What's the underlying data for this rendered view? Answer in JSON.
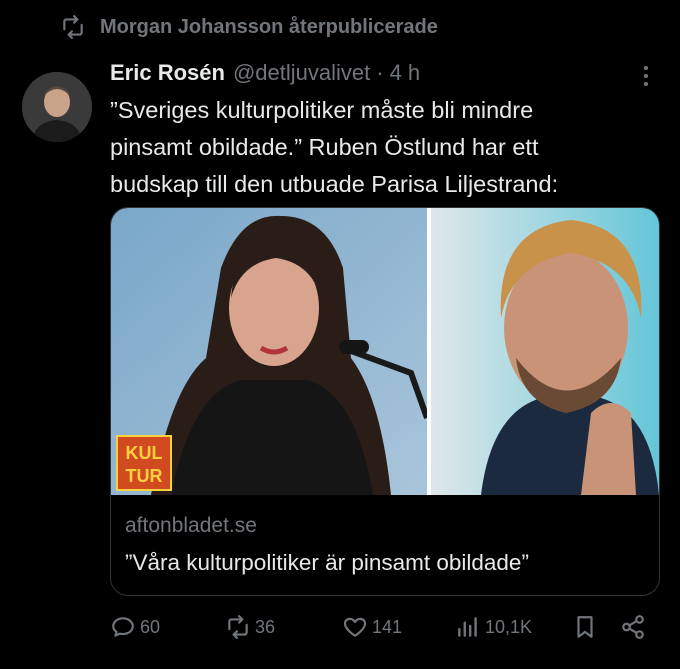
{
  "repost": {
    "icon": "repost-icon",
    "text": "Morgan Johansson återpublicerade"
  },
  "tweet": {
    "author": "Eric Rosén",
    "handle": "@detljuvalivet",
    "separator": "·",
    "time": "4 h",
    "lines": [
      "”Sveriges kulturpolitiker måste bli mindre",
      "pinsamt obildade.” Ruben Östlund har ett",
      "budskap till den utbuade Parisa Liljestrand:"
    ]
  },
  "card": {
    "badge_line1": "KUL",
    "badge_line2": "TUR",
    "domain": "aftonbladet.se",
    "title": "”Våra kulturpolitiker är pinsamt obildade”"
  },
  "actions": {
    "replies": "60",
    "reposts": "36",
    "likes": "141",
    "views": "10,1K"
  },
  "colors": {
    "background": "#000000",
    "text": "#e7e9ea",
    "muted": "#71767b",
    "border": "#2f3336",
    "badge_text": "#f7d23e",
    "badge_bg": "#d24a1f"
  }
}
